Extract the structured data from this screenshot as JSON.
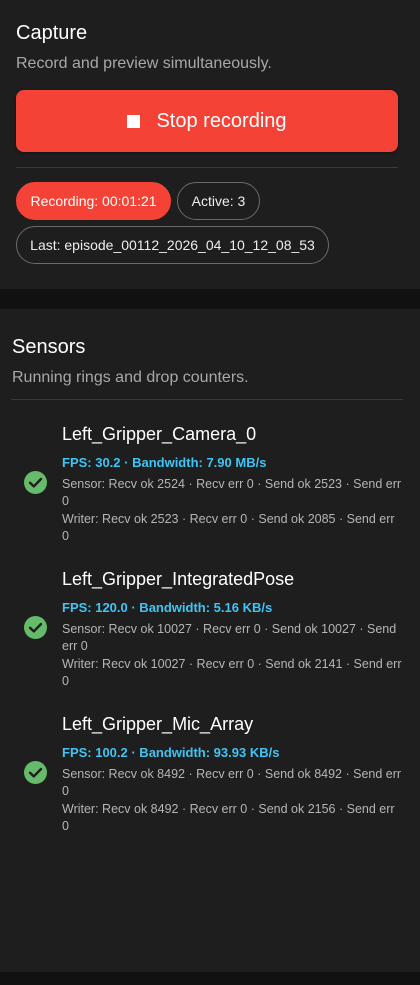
{
  "capture": {
    "title": "Capture",
    "subtitle": "Record and preview simultaneously.",
    "stop_button_label": "Stop recording",
    "stop_icon": "stop-square-icon",
    "chips": {
      "recording": "Recording: 00:01:21",
      "active": "Active: 3",
      "last": "Last: episode_00112_2026_04_10_12_08_53"
    },
    "colors": {
      "accent": "#f44336"
    }
  },
  "sensors": {
    "title": "Sensors",
    "subtitle": "Running rings and drop counters.",
    "status_icon": "check-circle-icon",
    "colors": {
      "ok": "#66bb6a",
      "metrics": "#3ec5f5"
    },
    "items": [
      {
        "name": "Left_Gripper_Camera_0",
        "metrics": "FPS: 30.2 · Bandwidth: 7.90 MB/s",
        "sensor_line": "Sensor: Recv ok 2524 · Recv err 0 · Send ok 2523 · Send err 0",
        "writer_line": "Writer: Recv ok 2523 · Recv err 0 · Send ok 2085 · Send err 0"
      },
      {
        "name": "Left_Gripper_IntegratedPose",
        "metrics": "FPS: 120.0 · Bandwidth: 5.16 KB/s",
        "sensor_line": "Sensor: Recv ok 10027 · Recv err 0 · Send ok 10027 · Send err 0",
        "writer_line": "Writer: Recv ok 10027 · Recv err 0 · Send ok 2141 · Send err 0"
      },
      {
        "name": "Left_Gripper_Mic_Array",
        "metrics": "FPS: 100.2 · Bandwidth: 93.93 KB/s",
        "sensor_line": "Sensor: Recv ok 8492 · Recv err 0 · Send ok 8492 · Send err 0",
        "writer_line": "Writer: Recv ok 8492 · Recv err 0 · Send ok 2156 · Send err 0"
      }
    ]
  }
}
